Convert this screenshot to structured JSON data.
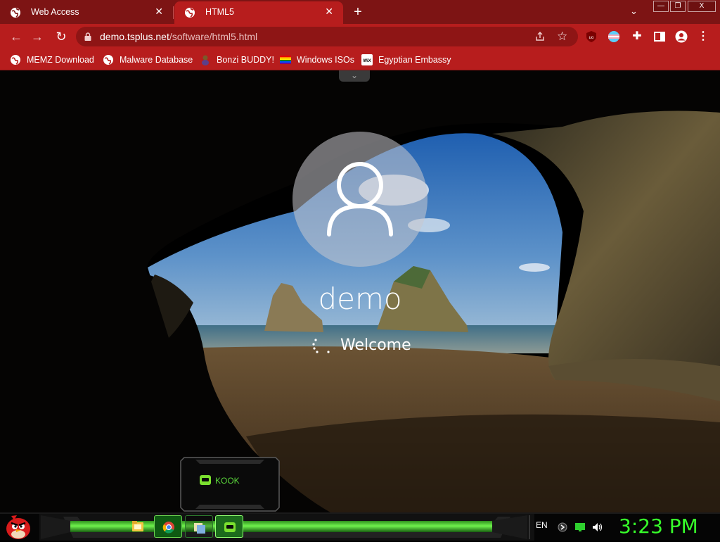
{
  "browser": {
    "tabs": [
      {
        "title": "Web Access",
        "active": false
      },
      {
        "title": "HTML5",
        "active": true
      }
    ],
    "url_host": "demo.tsplus.net",
    "url_path": "/software/html5.html",
    "bookmarks": [
      {
        "label": "MEMZ Download",
        "icon": "globe-icon"
      },
      {
        "label": "Malware Database",
        "icon": "globe-icon"
      },
      {
        "label": "Bonzi BUDDY!",
        "icon": "bonzi-icon"
      },
      {
        "label": "Windows ISOs",
        "icon": "rainbow-flag-icon"
      },
      {
        "label": "Egyptian Embassy",
        "icon": "wix-icon"
      }
    ],
    "colors": {
      "frame": "#7d1414",
      "toolbar": "#b71d1d",
      "omnibox": "#8e1515"
    }
  },
  "remote": {
    "user_name": "demo",
    "status": "Welcome",
    "popup_app": "KOOK"
  },
  "taskbar": {
    "apps": [
      {
        "name": "file-explorer-icon"
      },
      {
        "name": "chrome-icon"
      },
      {
        "name": "files-icon"
      },
      {
        "name": "kook-icon"
      }
    ],
    "language": "EN",
    "clock": "3:23 PM",
    "accent": "#37ff2a"
  }
}
